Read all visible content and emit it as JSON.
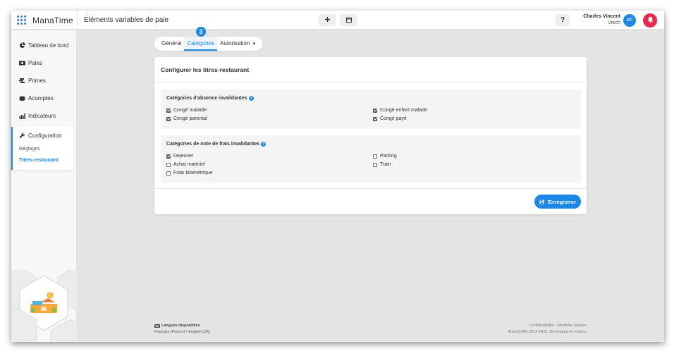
{
  "app": {
    "brand": "ManaTime",
    "page_title": "Éléments variables de paie"
  },
  "topbar": {
    "add_icon": "plus-icon",
    "calendar_icon": "calendar-icon",
    "help_label": "?",
    "user_name": "Charles Vincent",
    "user_company": "Vtech",
    "avatar_initials": "VC",
    "notification_icon": "bell-icon"
  },
  "sidebar": {
    "items": [
      {
        "label": "Tableau de bord",
        "icon": "pie-chart-icon"
      },
      {
        "label": "Paies",
        "icon": "money-icon"
      },
      {
        "label": "Primes",
        "icon": "coins-icon"
      },
      {
        "label": "Acomptes",
        "icon": "coin-stack-icon"
      },
      {
        "label": "Indicateurs",
        "icon": "bar-chart-icon"
      }
    ],
    "config": {
      "label": "Configuration",
      "icon": "wrench-icon",
      "sub_items": [
        "Réglages",
        "Titres-restaurant"
      ],
      "active_sub": "Titres-restaurant"
    }
  },
  "tabs": {
    "items": [
      "Général",
      "Catégories",
      "Autorisation"
    ],
    "active": "Catégories",
    "dropdown_caret": "▾",
    "step_badge": "3"
  },
  "card": {
    "title": "Configurer les titres-restaurant",
    "absence_section": {
      "title": "Catégories d'absence invalidantes",
      "items": [
        {
          "label": "Congé maladie",
          "checked": true
        },
        {
          "label": "Congé parental",
          "checked": true
        },
        {
          "label": "Congé enfant malade",
          "checked": true
        },
        {
          "label": "Congé payé",
          "checked": true
        }
      ]
    },
    "expense_section": {
      "title": "Catégories de note de frais invalidantes",
      "items": [
        {
          "label": "Dejeuner",
          "checked": true
        },
        {
          "label": "Achat matériel",
          "checked": false
        },
        {
          "label": "Frais kilométrique",
          "checked": false
        },
        {
          "label": "Parking",
          "checked": false
        },
        {
          "label": "Train",
          "checked": false
        }
      ]
    },
    "save_label": "Enregistrer"
  },
  "footer": {
    "languages_title": "Langues disponibles",
    "languages": "Français (France) • English (UK)",
    "legal_links": "Confidentialité • Mentions légales",
    "copyright": "ManaSoft© 2012-2025, Développé en France"
  },
  "colors": {
    "accent": "#1b87e6",
    "notification": "#e8294a",
    "background": "#e4e4e4"
  }
}
